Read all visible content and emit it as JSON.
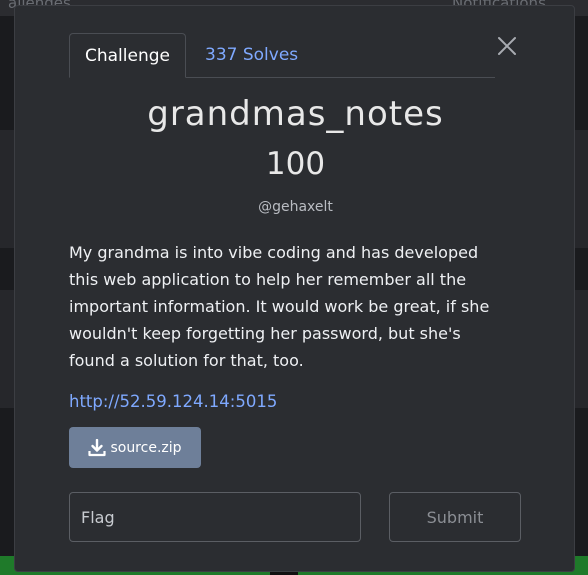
{
  "background": {
    "nav_left": "allenges",
    "nav_right": "Notifications"
  },
  "tabs": {
    "challenge": "Challenge",
    "solves": "337 Solves"
  },
  "challenge": {
    "name": "grandmas_notes",
    "points": "100",
    "author": "@gehaxelt",
    "description": "My grandma is into vibe coding and has developed this web application to help her remember all the important information. It would work be great, if she wouldn't keep forgetting her password, but she's found a solution for that, too.",
    "url": "http://52.59.124.14:5015",
    "file": "source.zip"
  },
  "form": {
    "flag_placeholder": "Flag",
    "submit_label": "Submit"
  },
  "icons": {
    "close": "close-icon",
    "download": "download-icon"
  },
  "colors": {
    "modal_bg": "#2b2d31",
    "link": "#7fa9ff",
    "file_button": "#6e7f99",
    "footer_green": "#1f7a2a"
  }
}
